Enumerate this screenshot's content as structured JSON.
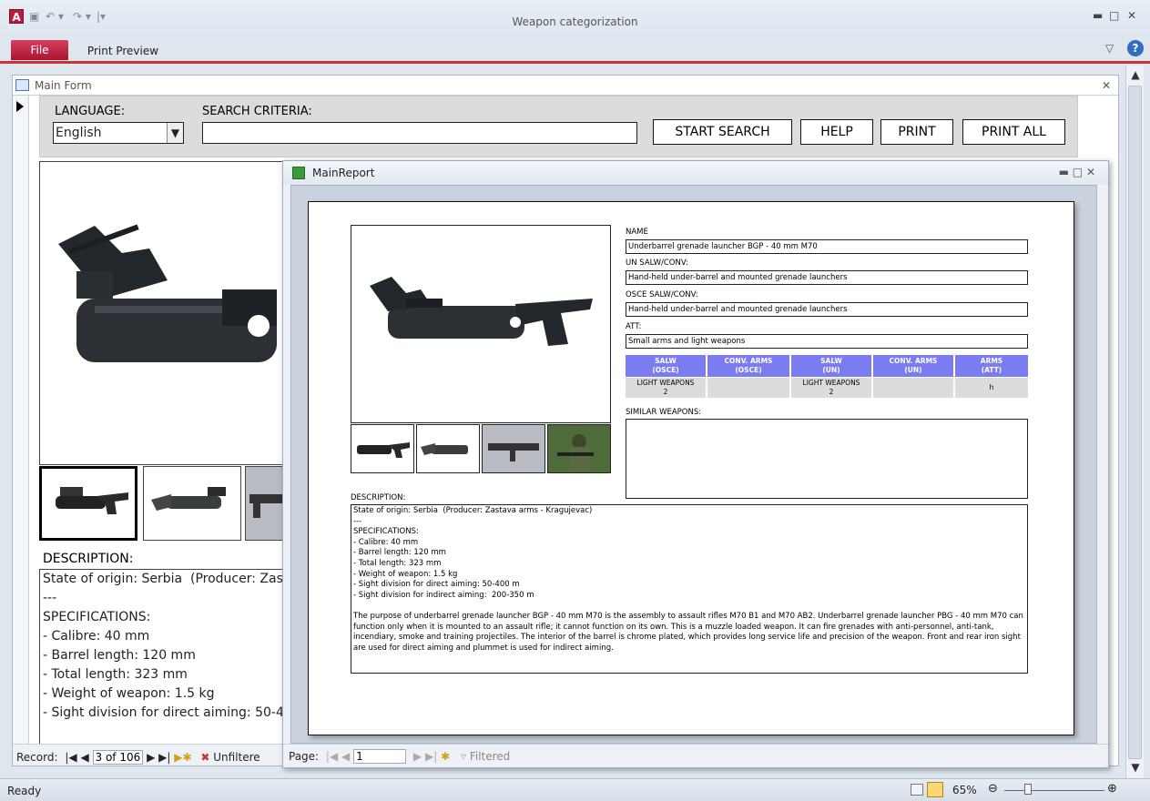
{
  "app": {
    "title": "Weapon categorization",
    "file_tab": "File",
    "print_preview_tab": "Print Preview",
    "status": "Ready",
    "zoom": "65%"
  },
  "main_form": {
    "title": "Main Form",
    "language_label": "LANGUAGE:",
    "language_value": "English",
    "search_label": "SEARCH CRITERIA:",
    "search_value": "",
    "buttons": {
      "start_search": "START SEARCH",
      "help": "HELP",
      "print": "PRINT",
      "print_all": "PRINT ALL"
    },
    "description_label": "DESCRIPTION:",
    "description_text": "State of origin: Serbia  (Producer: Zast\n---\nSPECIFICATIONS:\n- Calibre: 40 mm\n- Barrel length: 120 mm\n- Total length: 323 mm\n- Weight of weapon: 1.5 kg\n- Sight division for direct aiming: 50-4",
    "record_nav": {
      "label": "Record:",
      "current": "3 of 106",
      "filter": "Unfiltere"
    }
  },
  "report": {
    "title": "MainReport",
    "page_nav": {
      "label": "Page:",
      "current": "1",
      "filter": "Filtered"
    },
    "name_label": "NAME",
    "name_value": "Underbarrel grenade launcher BGP - 40 mm M70",
    "un_label": "UN SALW/CONV:",
    "un_value": "Hand-held under-barrel and mounted grenade launchers",
    "osce_label": "OSCE SALW/CONV:",
    "osce_value": "Hand-held under-barrel and mounted grenade launchers",
    "att_label": "ATT:",
    "att_value": "Small arms and light weapons",
    "table_headers": [
      "SALW\n(OSCE)",
      "CONV. ARMS\n(OSCE)",
      "SALW\n(UN)",
      "CONV. ARMS\n(UN)",
      "ARMS\n(ATT)"
    ],
    "table_values": [
      "LIGHT WEAPONS\n2",
      "",
      "LIGHT WEAPONS\n2",
      "",
      "h"
    ],
    "similar_label": "SIMILAR WEAPONS:",
    "description_label": "DESCRIPTION:",
    "description_text": "State of origin: Serbia  (Producer: Zastava arms - Kragujevac)\n---\nSPECIFICATIONS:\n- Calibre: 40 mm\n- Barrel length: 120 mm\n- Total length: 323 mm\n- Weight of weapon: 1.5 kg\n- Sight division for direct aiming: 50-400 m\n- Sight division for indirect aiming:  200-350 m\n\nThe purpose of underbarrel grenade launcher BGP - 40 mm M70 is the assembly to assault rifles M70 B1 and M70 AB2. Underbarrel grenade launcher PBG - 40 mm M70 can function only when it is mounted to an assault rifle; it cannot function on its own. This is a muzzle loaded weapon. It can fire grenades with anti-personnel, anti-tank, incendiary, smoke and training projectiles. The interior of the barrel is chrome plated, which provides long service life and precision of the weapon. Front and rear iron sight are used for direct aiming and plummet is used for indirect aiming."
  },
  "colors": {
    "accent": "#c8102e",
    "table_header": "#7b7cf0",
    "table_value": "#dcdcdc"
  }
}
